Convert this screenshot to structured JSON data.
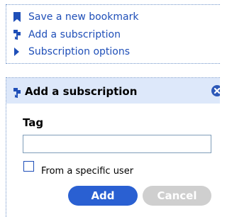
{
  "menu": {
    "items": [
      {
        "label": "Save a new bookmark",
        "icon": "bookmark-icon"
      },
      {
        "label": "Add a subscription",
        "icon": "subscription-icon"
      },
      {
        "label": "Subscription options",
        "icon": "arrow-right-icon"
      }
    ]
  },
  "panel": {
    "title": "Add a subscription",
    "title_icon": "subscription-icon",
    "close_icon": "close-icon",
    "tag_label": "Tag",
    "tag_value": "",
    "checkbox_label": "From a specific user",
    "checkbox_checked": false,
    "add_label": "Add",
    "cancel_label": "Cancel"
  },
  "colors": {
    "link": "#1f4fb8",
    "header_bg": "#dde8fa",
    "add_button": "#2a60d2",
    "cancel_button": "#cfcfcf",
    "border": "#6f93c9"
  }
}
